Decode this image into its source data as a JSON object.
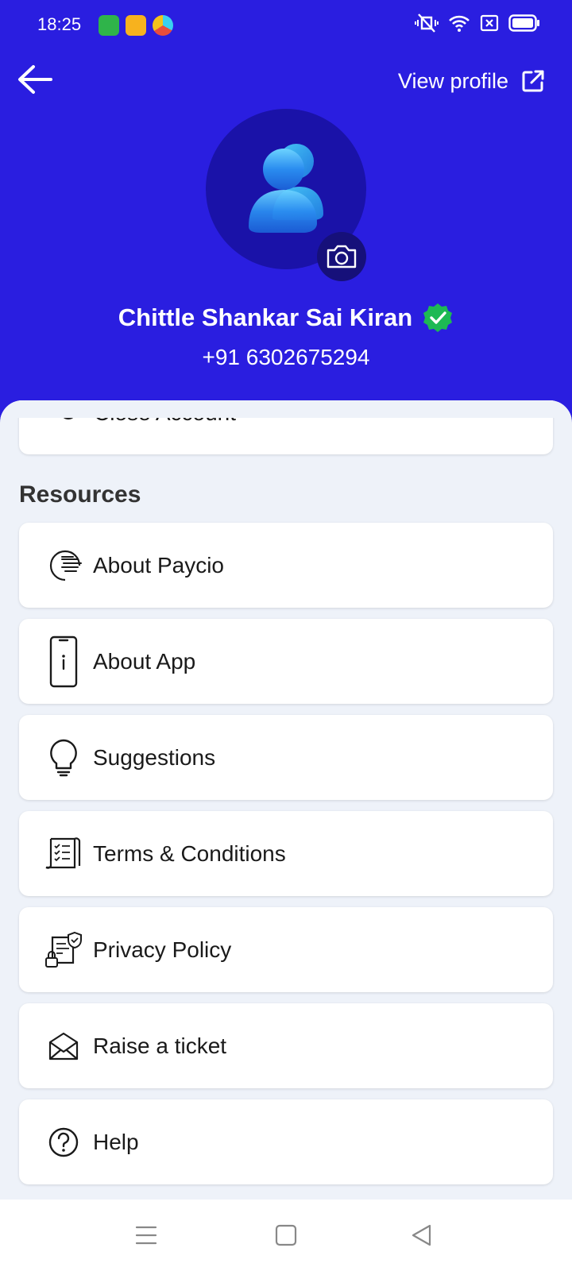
{
  "status_bar": {
    "time": "18:25"
  },
  "header": {
    "view_profile_label": "View profile",
    "name": "Chittle Shankar Sai Kiran",
    "phone": "+91 6302675294",
    "background_color": "#2a1ee0",
    "verified_color": "#1db954"
  },
  "partial_item": {
    "label": "Close Account"
  },
  "resources": {
    "title": "Resources",
    "items": [
      {
        "label": "About Paycio",
        "icon": "paycio-logo-icon"
      },
      {
        "label": "About App",
        "icon": "phone-info-icon"
      },
      {
        "label": "Suggestions",
        "icon": "lightbulb-icon"
      },
      {
        "label": "Terms & Conditions",
        "icon": "checklist-document-icon"
      },
      {
        "label": "Privacy Policy",
        "icon": "privacy-shield-document-icon"
      },
      {
        "label": "Raise a ticket",
        "icon": "envelope-open-icon"
      },
      {
        "label": "Help",
        "icon": "help-question-icon"
      }
    ]
  }
}
